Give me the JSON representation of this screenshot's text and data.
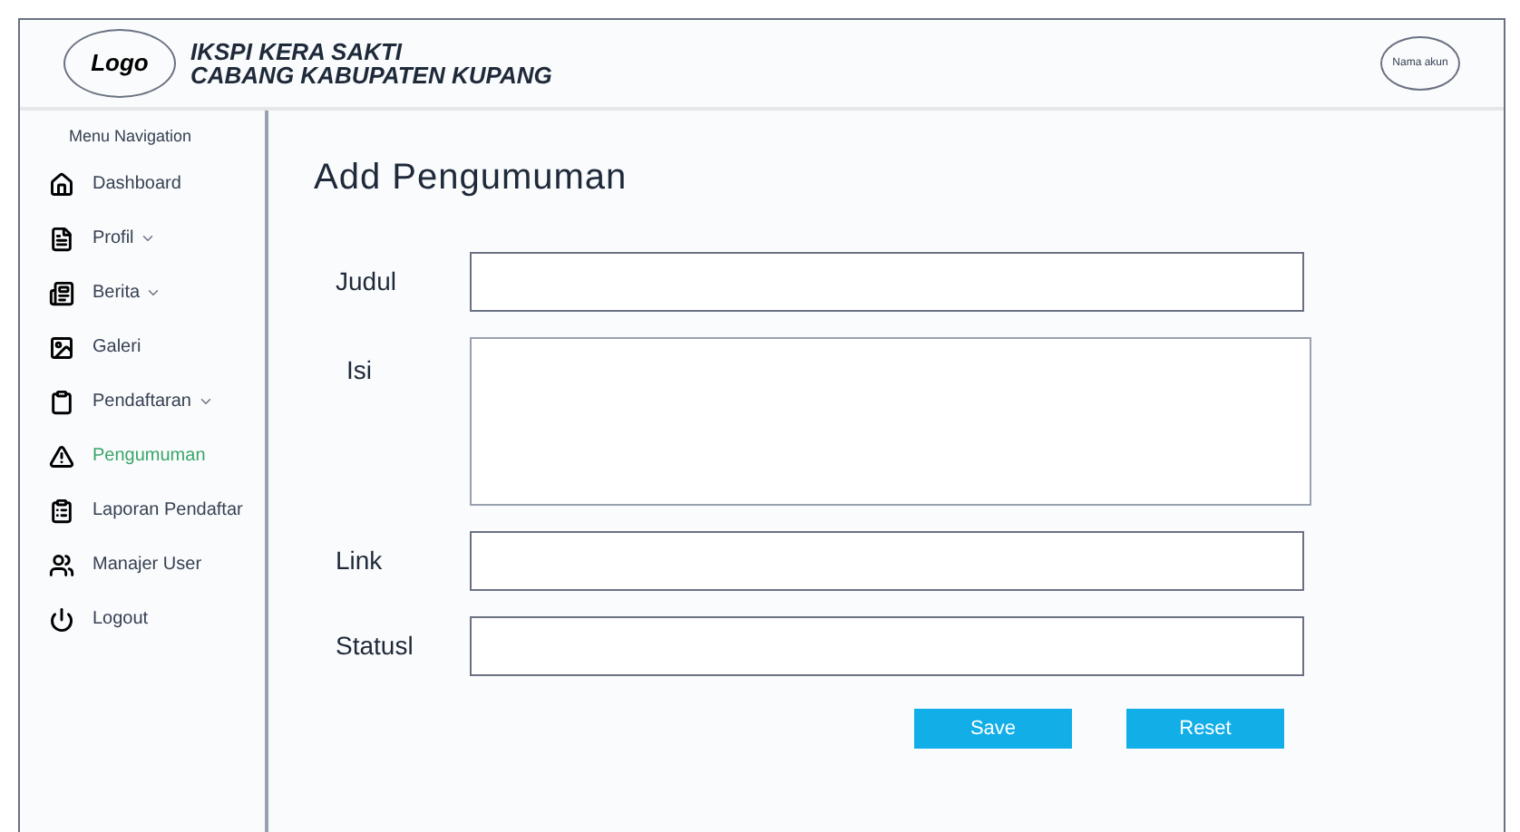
{
  "header": {
    "logo": "Logo",
    "title_lines": [
      "IKSPI KERA SAKTI",
      "CABANG KABUPATEN KUPANG"
    ],
    "account": "Nama akun"
  },
  "sidebar": {
    "heading": "Menu Navigation",
    "items": [
      {
        "label": "Dashboard",
        "dropdown": false,
        "selected": false
      },
      {
        "label": "Profil",
        "dropdown": true,
        "selected": false
      },
      {
        "label": "Berita",
        "dropdown": true,
        "selected": false
      },
      {
        "label": "Galeri",
        "dropdown": false,
        "selected": false
      },
      {
        "label": "Pendaftaran",
        "dropdown": true,
        "selected": false
      },
      {
        "label": "Pengumuman",
        "dropdown": false,
        "selected": true
      },
      {
        "label": "Laporan Pendaftar",
        "dropdown": false,
        "selected": false
      },
      {
        "label": "Manajer User",
        "dropdown": false,
        "selected": false
      },
      {
        "label": "Logout",
        "dropdown": false,
        "selected": false
      }
    ]
  },
  "form": {
    "title": "Add Pengumuman",
    "fields": [
      {
        "label": "Judul",
        "kind": "input"
      },
      {
        "label": "Isi",
        "kind": "textarea"
      },
      {
        "label": "Link",
        "kind": "input"
      },
      {
        "label": "Statusl",
        "kind": "input"
      }
    ],
    "buttons": [
      "Save",
      "Reset"
    ]
  }
}
